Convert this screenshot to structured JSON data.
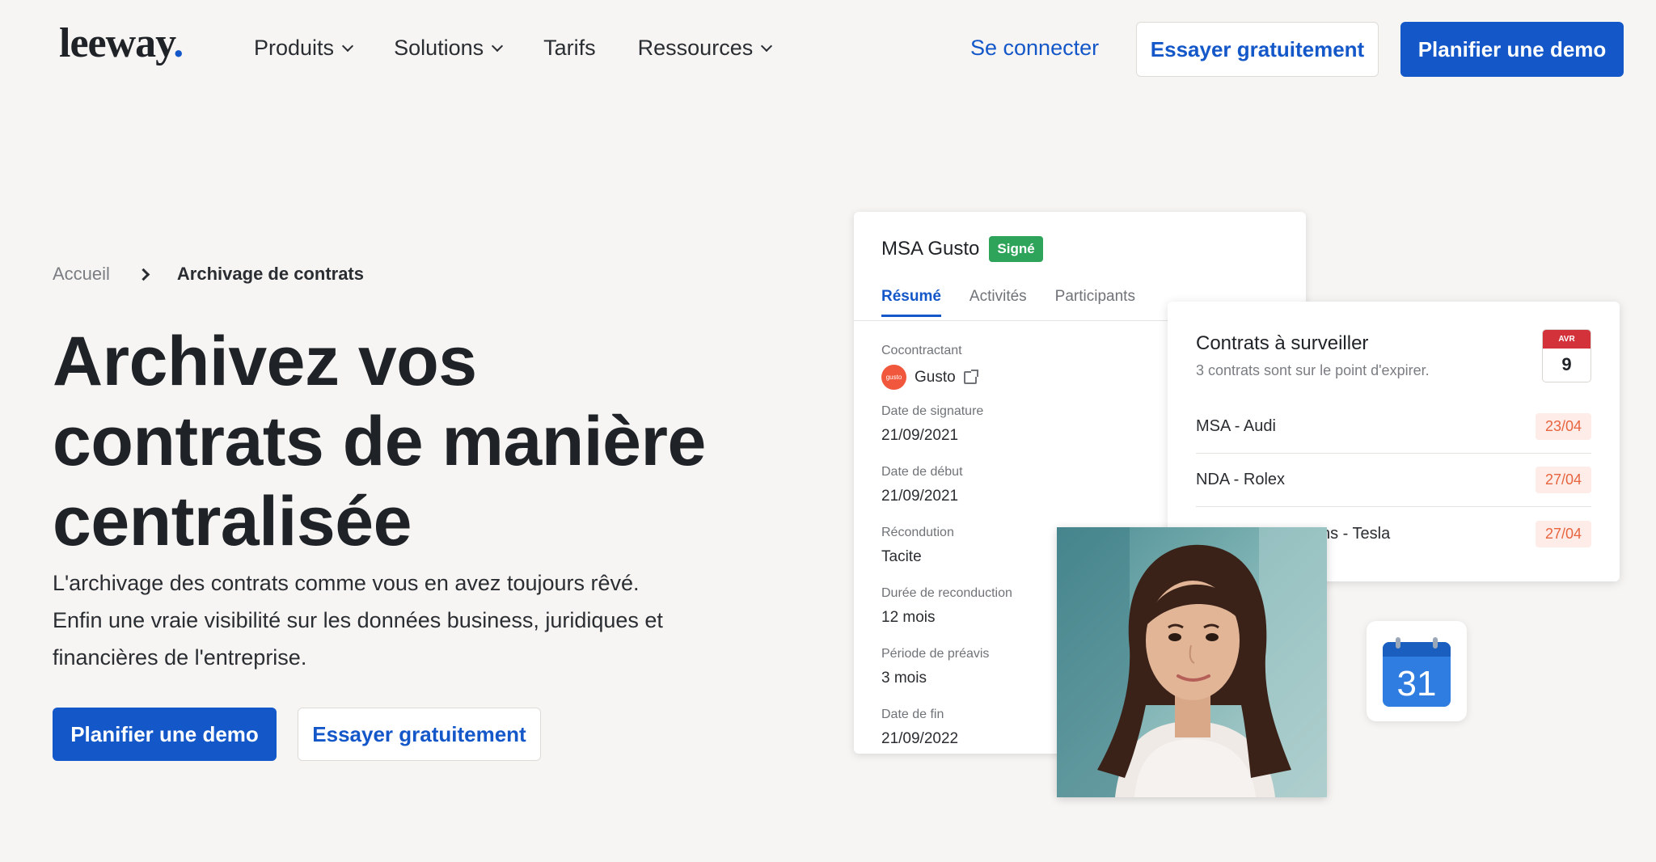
{
  "header": {
    "logo": "leeway",
    "logo_dot": ".",
    "nav": [
      {
        "label": "Produits",
        "has_dropdown": true
      },
      {
        "label": "Solutions",
        "has_dropdown": true
      },
      {
        "label": "Tarifs",
        "has_dropdown": false
      },
      {
        "label": "Ressources",
        "has_dropdown": true
      }
    ],
    "login": "Se connecter",
    "try_free": "Essayer gratuitement",
    "plan_demo": "Planifier une demo"
  },
  "breadcrumb": {
    "home": "Accueil",
    "current": "Archivage de contrats"
  },
  "hero": {
    "title_line1": "Archivez vos",
    "title_line2": "contrats de manière",
    "title_line3": "centralisée",
    "sub_line1": "L'archivage des contrats comme vous en avez toujours rêvé.",
    "sub_line2": "Enfin une vraie visibilité sur les données business, juridiques et",
    "sub_line3": "financières de l'entreprise.",
    "cta_primary": "Planifier une demo",
    "cta_secondary": "Essayer gratuitement"
  },
  "contract_card": {
    "title": "MSA Gusto",
    "status": "Signé",
    "tabs": [
      "Résumé",
      "Activités",
      "Participants"
    ],
    "fields": {
      "cocontractant": {
        "label": "Cocontractant",
        "value": "Gusto",
        "logo_text": "gusto"
      },
      "signature": {
        "label": "Date de signature",
        "value": "21/09/2021"
      },
      "debut": {
        "label": "Date de début",
        "value": "21/09/2021"
      },
      "reconduction": {
        "label": "Récondution",
        "value": "Tacite"
      },
      "duree": {
        "label": "Durée de reconduction",
        "value": "12 mois"
      },
      "preavis": {
        "label": "Période de préavis",
        "value": "3 mois"
      },
      "fin": {
        "label": "Date de fin",
        "value": "21/09/2022"
      }
    }
  },
  "watch_card": {
    "title": "Contrats à surveiller",
    "subtitle": "3 contrats sont sur le point d'expirer.",
    "calendar": {
      "month": "AVR",
      "day": "9"
    },
    "rows": [
      {
        "name": "MSA - Audi",
        "date": "23/04"
      },
      {
        "name": "NDA - Rolex",
        "date": "27/04"
      },
      {
        "name": "ns - Tesla",
        "date": "27/04"
      }
    ]
  },
  "gcal": {
    "day": "31"
  },
  "colors": {
    "brand_blue": "#1357c9",
    "background": "#f7f5f3",
    "signed_green": "#2ea35a",
    "date_badge_text": "#e8643f",
    "date_badge_bg": "#fdece7"
  }
}
